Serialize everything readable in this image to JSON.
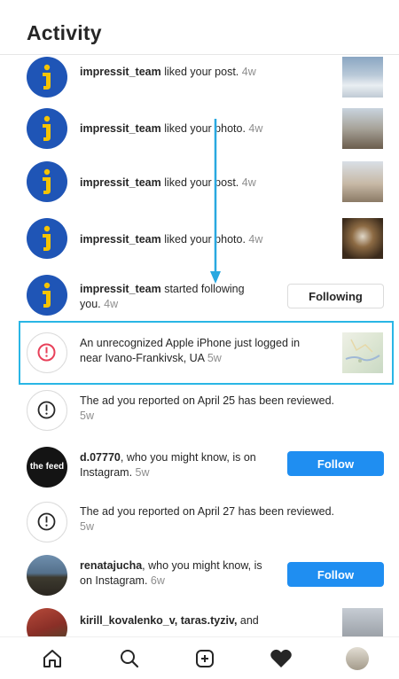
{
  "header": {
    "title": "Activity"
  },
  "items": [
    {
      "user": "impressit_team",
      "text": "liked your post.",
      "time": "4w"
    },
    {
      "user": "impressit_team",
      "text": "liked your photo.",
      "time": "4w"
    },
    {
      "user": "impressit_team",
      "text": "liked your post.",
      "time": "4w"
    },
    {
      "user": "impressit_team",
      "text": "liked your photo.",
      "time": "4w"
    },
    {
      "user": "impressit_team",
      "text": "started following you.",
      "time": "4w",
      "button": "Following"
    },
    {
      "text": "An unrecognized Apple iPhone just logged in near Ivano-Frankivsk, UA",
      "time": "5w"
    },
    {
      "text": "The ad you reported on April 25 has been reviewed.",
      "time": "5w"
    },
    {
      "avatar_label": "the feed",
      "user": "d.07770",
      "text": ", who you might know, is on Instagram.",
      "time": "5w",
      "button": "Follow"
    },
    {
      "text": "The ad you reported on April 27 has been reviewed.",
      "time": "5w"
    },
    {
      "user": "renatajucha",
      "text": ", who you might know, is on Instagram.",
      "time": "6w",
      "button": "Follow"
    },
    {
      "user": "kirill_kovalenko_v, taras.tyziv,",
      "text": "and"
    }
  ],
  "tabs": [
    "home-icon",
    "search-icon",
    "add-post-icon",
    "activity-heart-icon",
    "profile-avatar"
  ],
  "colors": {
    "brand_avatar": "#1f55b6",
    "follow_button": "#1f8ef1",
    "highlight_frame": "#29b6e5",
    "alert_red": "#e8415a"
  }
}
